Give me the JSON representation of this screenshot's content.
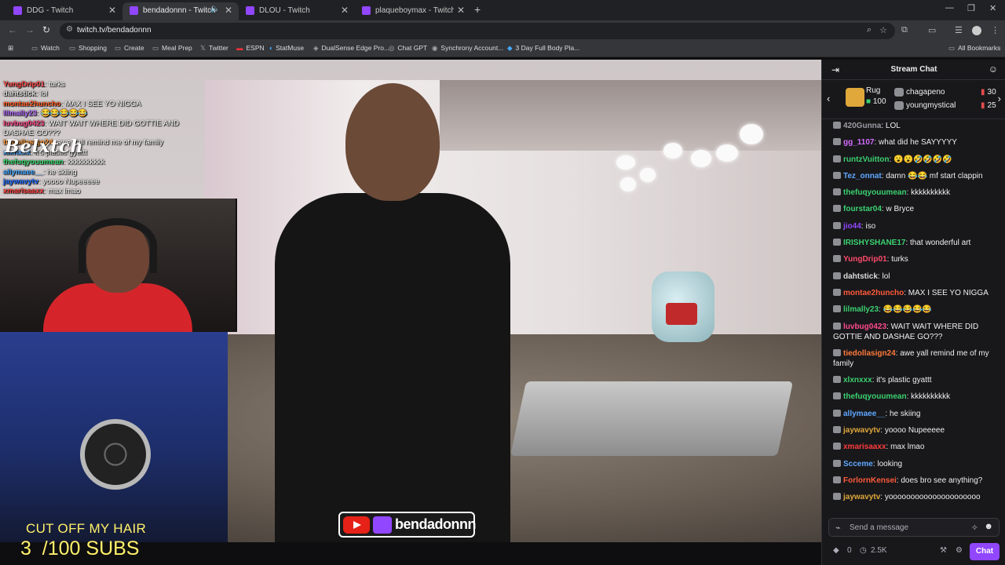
{
  "tabs": [
    {
      "title": "DDG - Twitch"
    },
    {
      "title": "bendadonnn - Twitch"
    },
    {
      "title": "DLOU - Twitch"
    },
    {
      "title": "plaqueboymax - Twitch"
    }
  ],
  "address": {
    "url": "twitch.tv/bendadonnn"
  },
  "bookmarks": [
    "Watch",
    "Shopping",
    "Create",
    "Meal Prep",
    "Twitter",
    "ESPN",
    "StatMuse",
    "DualSense Edge Pro...",
    "Chat GPT",
    "Synchrony Account...",
    "3 Day Full Body Pla..."
  ],
  "all_bookmarks": "All Bookmarks",
  "overlay": {
    "chat": [
      {
        "user": "YungDrip01",
        "text": "turks",
        "color": "#ff4a4a"
      },
      {
        "user": "dahtstick",
        "text": "lol",
        "color": "#dddddd"
      },
      {
        "user": "montae2huncho",
        "text": "MAX I SEE YO NIGGA",
        "color": "#ff5a1f"
      },
      {
        "user": "lilmally23",
        "text": "😂😂😂😂😂",
        "color": "#b26bff"
      },
      {
        "user": "luvbug0423",
        "text": "WAIT WAIT WHERE DID GOTTIE AND DASHAE GO???",
        "color": "#ff4a8a"
      },
      {
        "user": "tiedollasign24",
        "text": "awe yall remind me of my family",
        "color": "#ff9a3c"
      },
      {
        "user": "xlxnxxx",
        "text": "it's plastic gyattt",
        "color": "#4aa8ff"
      },
      {
        "user": "thefuqyouumean",
        "text": "kkkkkkkkkk",
        "color": "#37d86b"
      },
      {
        "user": "allymaee__",
        "text": "he skiing",
        "color": "#3ea6ff"
      },
      {
        "user": "jaywavytv",
        "text": "yoooo Nupeeeee",
        "color": "#1e6cff"
      },
      {
        "user": "xmarisaaxx",
        "text": "max lmao",
        "color": "#ff3b3b"
      }
    ],
    "signature": "Belxtch",
    "goal_line1": "CUT OFF MY HAIR",
    "goal_line2": "3  /100 SUBS",
    "brand_name": "bendadonnn"
  },
  "chat": {
    "title": "Stream Chat",
    "leaderboard": {
      "gift_user": "Rug",
      "gift_count": "100",
      "entries": [
        {
          "name": "chagapeno",
          "count": "30"
        },
        {
          "name": "youngmystical",
          "count": "25"
        }
      ]
    },
    "messages": [
      {
        "user": "420Gunna",
        "text": "LOL",
        "color": "#9c9ca3"
      },
      {
        "user": "gg_1107",
        "text": "what did he SAYYYYY",
        "color": "#d56bff"
      },
      {
        "user": "runtzVuitton",
        "text": "😮😮🤣🤣🤣🤣",
        "color": "#3bd16f"
      },
      {
        "user": "Tez_onnat",
        "text": "damn 😂😂 mf start clappin",
        "color": "#5fa8ff"
      },
      {
        "user": "thefuqyouumean",
        "text": "kkkkkkkkkk",
        "color": "#3bd16f"
      },
      {
        "user": "fourstar04",
        "text": "w Bryce",
        "color": "#3bd16f"
      },
      {
        "user": "jio44",
        "text": "iso",
        "color": "#9146ff"
      },
      {
        "user": "IRISHYSHANE17",
        "text": "that wonderful art",
        "color": "#3bd16f"
      },
      {
        "user": "YungDrip01",
        "text": "turks",
        "color": "#ff4a6a"
      },
      {
        "user": "dahtstick",
        "text": "lol",
        "color": "#dddddd"
      },
      {
        "user": "montae2huncho",
        "text": "MAX I SEE YO NIGGA",
        "color": "#ff5a3a"
      },
      {
        "user": "lilmally23",
        "text": "😂😂😂😂😂",
        "color": "#3bd16f"
      },
      {
        "user": "luvbug0423",
        "text": "WAIT WAIT WHERE DID GOTTIE AND DASHAE GO???",
        "color": "#ff4a8a"
      },
      {
        "user": "tiedollasign24",
        "text": "awe yall remind me of my family",
        "color": "#ff7a3a"
      },
      {
        "user": "xlxnxxx",
        "text": "it's plastic gyattt",
        "color": "#3bd16f"
      },
      {
        "user": "thefuqyouumean",
        "text": "kkkkkkkkkk",
        "color": "#3bd16f"
      },
      {
        "user": "allymaee__",
        "text": "he skiing",
        "color": "#5fa8ff"
      },
      {
        "user": "jaywavytv",
        "text": "yoooo Nupeeeee",
        "color": "#e0a83a"
      },
      {
        "user": "xmarisaaxx",
        "text": "max lmao",
        "color": "#ff3b3b"
      },
      {
        "user": "Scceme",
        "text": "looking",
        "color": "#5fa8ff"
      },
      {
        "user": "ForlornKensei",
        "text": "does bro see anything?",
        "color": "#ff5a3a"
      },
      {
        "user": "jaywavytv",
        "text": "yooooooooooooooooooooo",
        "color": "#e0a83a"
      }
    ],
    "input_placeholder": "Send a message",
    "points": "0",
    "viewers": "2.5K",
    "chat_button": "Chat"
  },
  "icons": {
    "tab": "twitch-favicon",
    "bits": "bits-icon",
    "viewers": "clock-icon"
  }
}
